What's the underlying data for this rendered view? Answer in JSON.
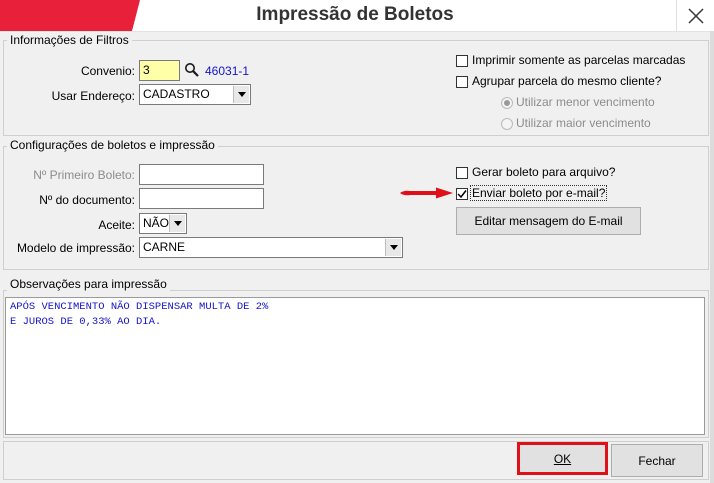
{
  "window": {
    "title": "Impressão de Boletos"
  },
  "filtros": {
    "group_title": "Informações de Filtros",
    "convenio_label": "Convenio:",
    "convenio_value": "3",
    "convenio_code": "46031-1",
    "endereco_label": "Usar Endereço:",
    "endereco_value": "CADASTRO",
    "chk_parcelas_marcadas": "Imprimir somente as parcelas marcadas",
    "chk_agrupar": "Agrupar parcela do mesmo cliente?",
    "radio_menor": "Utilizar menor vencimento",
    "radio_maior": "Utilizar maior vencimento"
  },
  "config": {
    "group_title": "Configurações de boletos e impressão",
    "primeiro_boleto_label": "Nº Primeiro Boleto:",
    "documento_label": "Nº do documento:",
    "aceite_label": "Aceite:",
    "aceite_value": "NÃO",
    "modelo_label": "Modelo de impressão:",
    "modelo_value": "CARNE",
    "chk_gerar_arquivo": "Gerar boleto para arquivo?",
    "chk_enviar_email": "Enviar boleto por e-mail?",
    "editar_mensagem_button": "Editar mensagem do E-mail"
  },
  "observacoes": {
    "group_title": "Observações para impressão",
    "text": "APÓS VENCIMENTO NÃO DISPENSAR MULTA DE 2%\nE JUROS DE 0,33% AO DIA."
  },
  "footer": {
    "ok_button": "OK",
    "fechar_button": "Fechar"
  },
  "colors": {
    "title_accent": "#e8203a",
    "annotation_red": "#e0101a",
    "link_blue": "#1414c8"
  },
  "icons": {
    "close": "close-icon",
    "search": "magnifier-icon",
    "annotation": "red-arrow-icon"
  }
}
